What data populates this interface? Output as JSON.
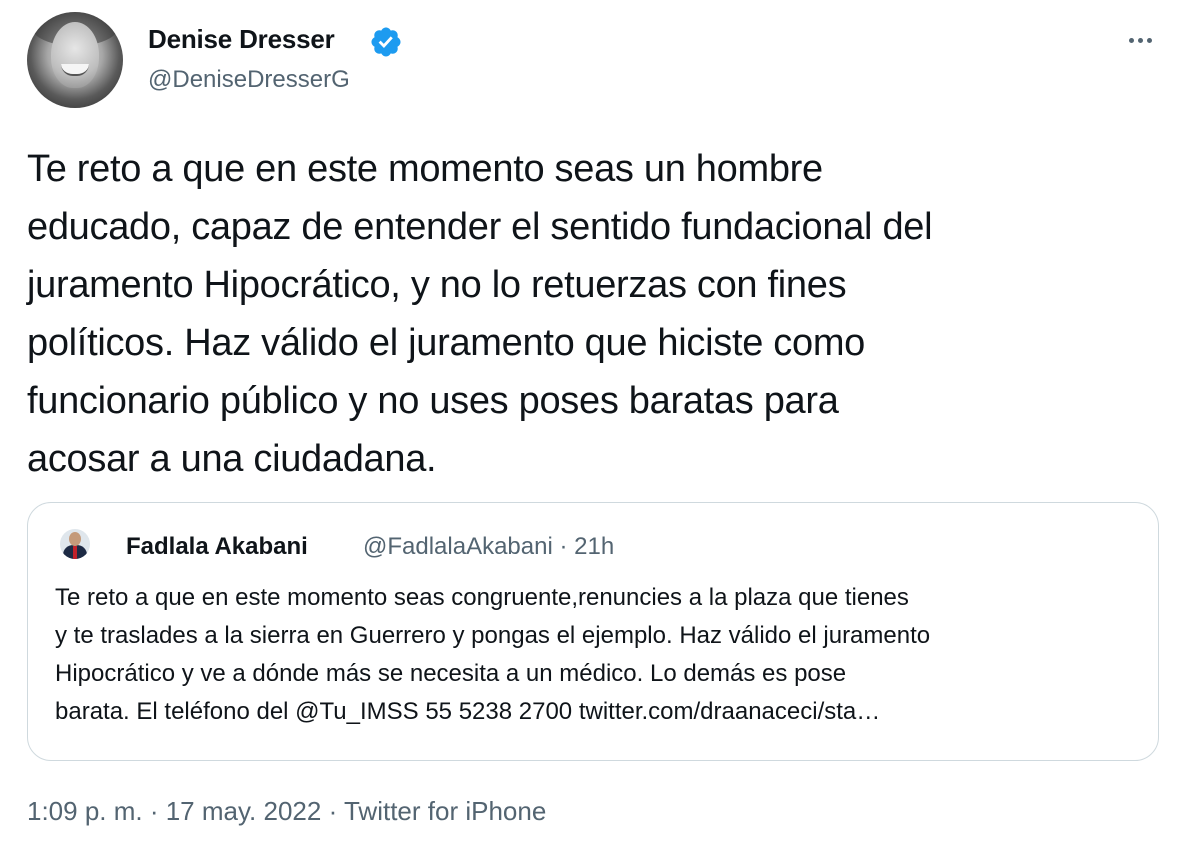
{
  "author": {
    "display_name": "Denise Dresser",
    "handle": "@DeniseDresserG",
    "verified": true
  },
  "tweet": {
    "text": "Te reto a que en este momento seas un hombre\neducado, capaz de entender el sentido fundacional del\njuramento Hipocrático, y no lo retuerzas con fines\npolíticos. Haz válido el juramento que hiciste como\nfuncionario público y no uses poses baratas para\nacosar a una ciudadana."
  },
  "quoted_tweet": {
    "display_name": "Fadlala Akabani",
    "meta": "@FadlalaAkabani · 21h",
    "text": "Te reto a que en este momento seas congruente,renuncies  a la plaza que tienes\ny te traslades a la sierra en Guerrero y pongas el ejemplo. Haz válido el juramento\nHipocrático y ve a dónde más se necesita a un médico. Lo demás es pose\nbarata. El teléfono del @Tu_IMSS  55 5238 2700 twitter.com/draanaceci/sta…"
  },
  "footer": {
    "timestamp": "1:09 p. m. · 17 may. 2022 · Twitter for iPhone"
  },
  "icons": {
    "verified": "verified-badge-icon",
    "more": "more-options-icon"
  },
  "colors": {
    "verified": "#1d9bf0",
    "secondary_text": "#536471",
    "border": "#cfd9de"
  }
}
